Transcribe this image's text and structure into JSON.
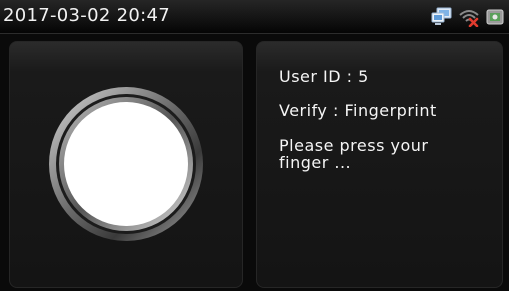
{
  "status_bar": {
    "datetime": "2017-03-02 20:47",
    "icons": [
      "network-icon",
      "wifi-disconnected-icon",
      "usb-icon"
    ]
  },
  "verify_panel": {
    "user_id": "User ID : 5",
    "verify_mode": "Verify : Fingerprint",
    "prompt_line1": "Please press your",
    "prompt_line2": "finger ..."
  },
  "colors": {
    "background": "#0a0a0a",
    "panel": "#161616",
    "text": "#f5f5f5",
    "ring": "#bdbdbd",
    "wifi_error": "#e23b2e",
    "network_icon": "#7fb3e6"
  }
}
